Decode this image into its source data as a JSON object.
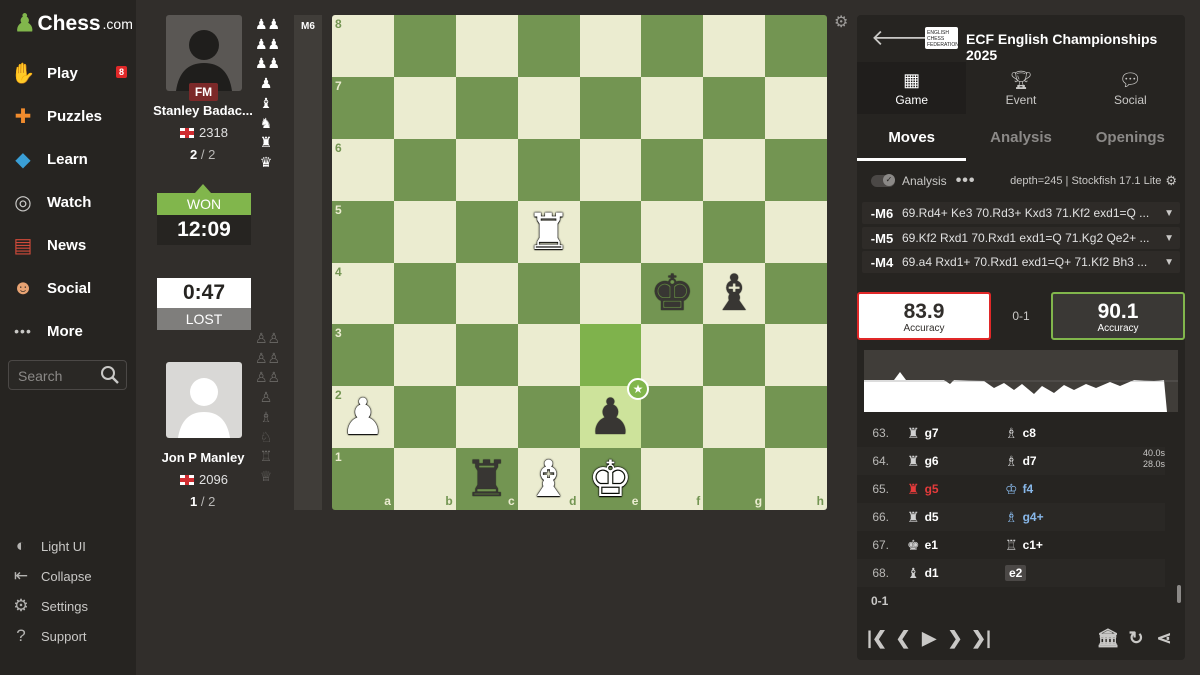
{
  "brand": {
    "name": "Chess",
    "suffix": ".com"
  },
  "nav": [
    {
      "label": "Play",
      "icon": "play-hand-icon",
      "badge": "8"
    },
    {
      "label": "Puzzles",
      "icon": "puzzle-icon"
    },
    {
      "label": "Learn",
      "icon": "learn-cap-icon"
    },
    {
      "label": "Watch",
      "icon": "binoculars-icon"
    },
    {
      "label": "News",
      "icon": "newspaper-icon"
    },
    {
      "label": "Social",
      "icon": "people-icon"
    },
    {
      "label": "More",
      "icon": "more-dots-icon"
    }
  ],
  "search": {
    "placeholder": "Search"
  },
  "bottom_nav": [
    "Light UI",
    "Collapse",
    "Settings",
    "Support"
  ],
  "top_player": {
    "title": "FM",
    "name": "Stanley Badac...",
    "rating": "2318",
    "score": "2",
    "score_total": "/ 2",
    "result": "WON",
    "clock": "12:09"
  },
  "bottom_player": {
    "name": "Jon P Manley",
    "rating": "2096",
    "score": "1",
    "score_total": "/ 2",
    "result": "LOST",
    "clock": "0:47"
  },
  "captured_top": [
    "♟♟",
    "♟♟",
    "♟♟",
    "♟",
    "♝",
    "♞",
    "♜",
    "♛"
  ],
  "captured_bottom": [
    "♙♙",
    "♙♙",
    "♙♙",
    "♙",
    "♗",
    "♘",
    "♖",
    "♕"
  ],
  "eval_label": "M6",
  "board": {
    "ranks": [
      "8",
      "7",
      "6",
      "5",
      "4",
      "3",
      "2",
      "1"
    ],
    "files": [
      "a",
      "b",
      "c",
      "d",
      "e",
      "f",
      "g",
      "h"
    ],
    "pieces": [
      {
        "sq": "d5",
        "glyph": "♜",
        "color": "w"
      },
      {
        "sq": "f4",
        "glyph": "♚",
        "color": "b"
      },
      {
        "sq": "g4",
        "glyph": "♝",
        "color": "b"
      },
      {
        "sq": "a2",
        "glyph": "♟",
        "color": "w"
      },
      {
        "sq": "e2",
        "glyph": "♟",
        "color": "b"
      },
      {
        "sq": "c1",
        "glyph": "♜",
        "color": "b"
      },
      {
        "sq": "d1",
        "glyph": "♝",
        "color": "w"
      },
      {
        "sq": "e1",
        "glyph": "♚",
        "color": "w"
      }
    ],
    "highlights": [
      "e3",
      "e2"
    ]
  },
  "event": {
    "logo_text": "ENGLISH CHESS FEDERATION",
    "title": "ECF English Championships 2025"
  },
  "panel_tabs": [
    {
      "label": "Game",
      "icon": "board-icon"
    },
    {
      "label": "Event",
      "icon": "trophy-icon"
    },
    {
      "label": "Social",
      "icon": "chat-icon"
    }
  ],
  "sub_tabs": [
    "Moves",
    "Analysis",
    "Openings"
  ],
  "analysis": {
    "label": "Analysis",
    "engine": "depth=245 | Stockfish 17.1 Lite"
  },
  "engine_lines": [
    {
      "eval": "-M6",
      "moves": "69.Rd4+ Ke3 70.Rd3+ Kxd3 71.Kf2 exd1=Q ..."
    },
    {
      "eval": "-M5",
      "moves": "69.Kf2 Rxd1 70.Rxd1 exd1=Q 71.Kg2 Qe2+ ..."
    },
    {
      "eval": "-M4",
      "moves": "69.a4 Rxd1+ 70.Rxd1 exd1=Q+ 71.Kf2 Bh3 ..."
    }
  ],
  "accuracy": {
    "white": "83.9",
    "black": "90.1",
    "label": "Accuracy",
    "result": "0-1"
  },
  "moves": [
    {
      "n": "63.",
      "wp": "♜",
      "w": "g7",
      "bp": "♗",
      "b": "c8"
    },
    {
      "n": "64.",
      "wp": "♜",
      "w": "g6",
      "bp": "♗",
      "b": "d7"
    },
    {
      "n": "65.",
      "wp": "♜",
      "w": "g5",
      "bp": "♔",
      "b": "f4"
    },
    {
      "n": "66.",
      "wp": "♜",
      "w": "d5",
      "bp": "♗",
      "b": "g4+"
    },
    {
      "n": "67.",
      "wp": "♚",
      "w": "e1",
      "bp": "♖",
      "b": "c1+"
    },
    {
      "n": "68.",
      "wp": "♝",
      "w": "d1",
      "bp": "",
      "b": "e2"
    }
  ],
  "times": [
    "40.0s",
    "28.0s"
  ],
  "final_result": "0-1",
  "colors": {
    "accent": "#81b64c",
    "danger": "#e02828",
    "board_light": "#ebecd0",
    "board_dark": "#739552"
  }
}
